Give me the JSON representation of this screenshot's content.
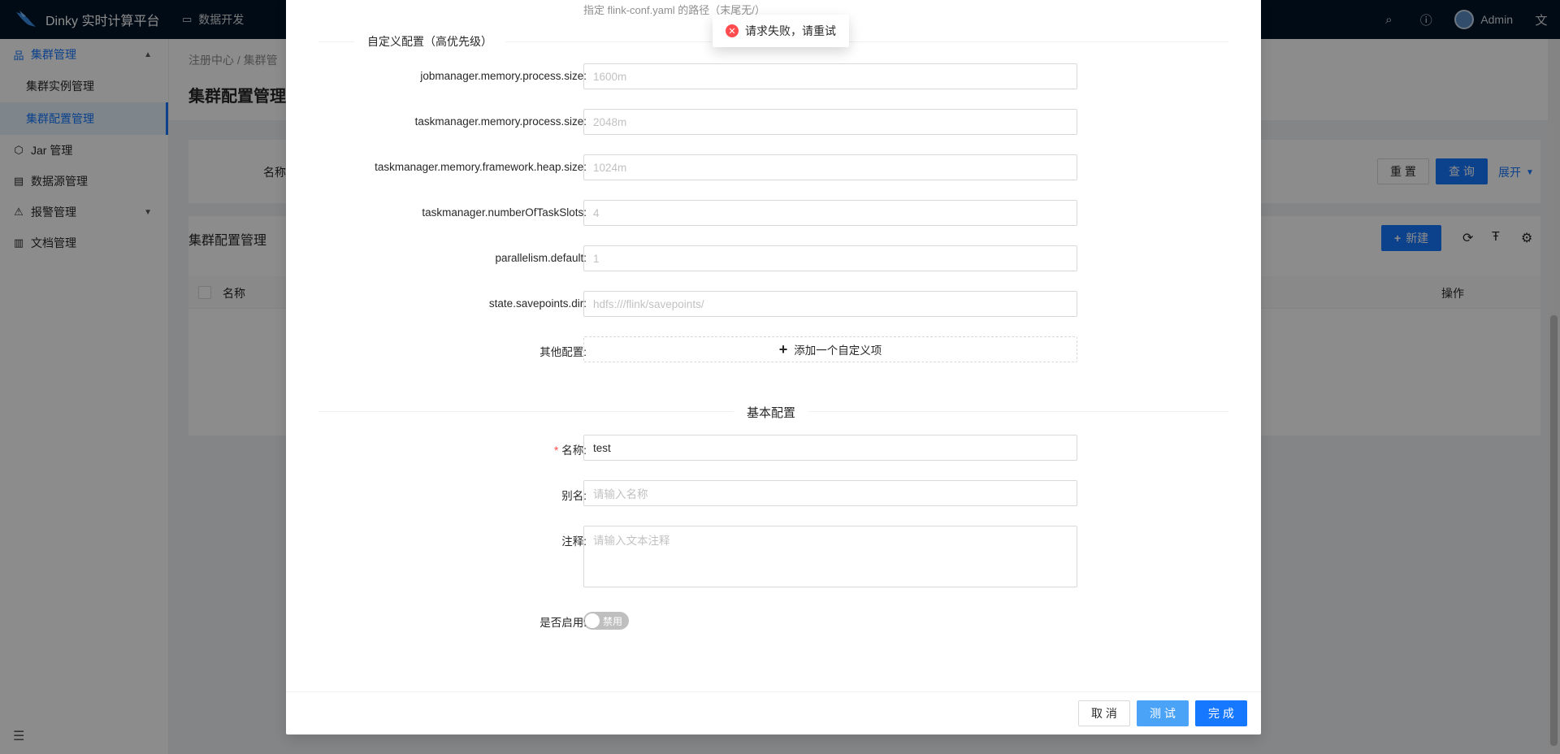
{
  "app": {
    "title": "Dinky 实时计算平台",
    "top_nav": [
      {
        "label": "数据开发"
      }
    ],
    "user_name": "Admin"
  },
  "sidebar": {
    "items": [
      {
        "label": "集群管理",
        "open": true
      },
      {
        "label": "集群实例管理"
      },
      {
        "label": "集群配置管理",
        "active": true
      },
      {
        "label": "Jar 管理"
      },
      {
        "label": "数据源管理"
      },
      {
        "label": "报警管理"
      },
      {
        "label": "文档管理"
      }
    ]
  },
  "page": {
    "breadcrumb": [
      "注册中心",
      "集群管"
    ],
    "title": "集群配置管理",
    "search_label": "名称",
    "reset_label": "重 置",
    "query_label": "查 询",
    "expand_label": "展开",
    "table_title": "集群配置管理",
    "new_label": "新建",
    "col_name": "名称",
    "col_action": "操作"
  },
  "modal": {
    "hint": "指定 flink-conf.yaml 的路径（末尾无/）",
    "custom_section_title": "自定义配置（高优先级）",
    "fields": [
      {
        "label": "jobmanager.memory.process.size:",
        "placeholder": "1600m"
      },
      {
        "label": "taskmanager.memory.process.size:",
        "placeholder": "2048m"
      },
      {
        "label": "taskmanager.memory.framework.heap.size:",
        "placeholder": "1024m"
      },
      {
        "label": "taskmanager.numberOfTaskSlots:",
        "placeholder": "4"
      },
      {
        "label": "parallelism.default:",
        "placeholder": "1"
      },
      {
        "label": "state.savepoints.dir:",
        "placeholder": "hdfs:///flink/savepoints/"
      }
    ],
    "other_config_label": "其他配置:",
    "add_custom_label": "添加一个自定义项",
    "basic_section_title": "基本配置",
    "name_label": "名称:",
    "name_value": "test",
    "alias_label": "别名:",
    "alias_placeholder": "请输入名称",
    "note_label": "注释:",
    "note_placeholder": "请输入文本注释",
    "enabled_label": "是否启用:",
    "enabled_state": "禁用",
    "cancel_label": "取 消",
    "test_label": "测 试",
    "done_label": "完 成"
  },
  "toast": {
    "message": "请求失败，请重试"
  },
  "colors": {
    "primary": "#1677ff",
    "header_bg": "#001529",
    "error": "#ff4d4f"
  }
}
